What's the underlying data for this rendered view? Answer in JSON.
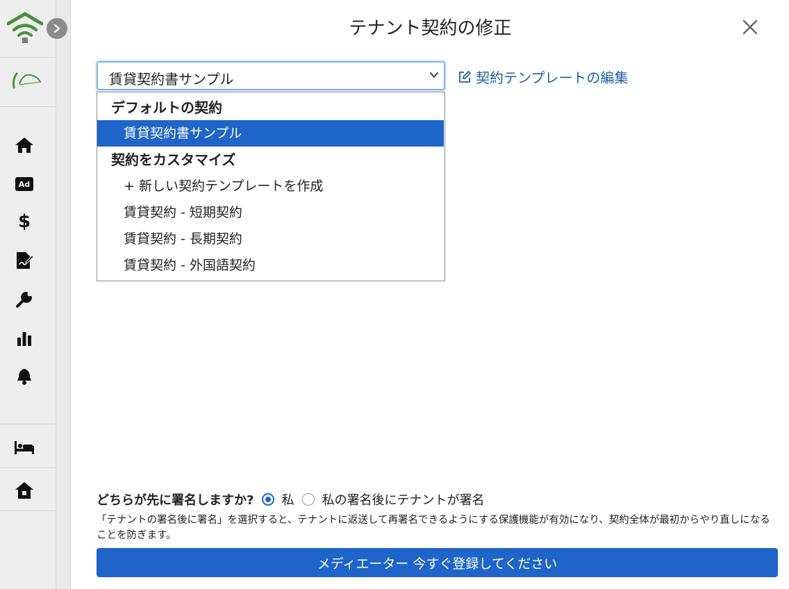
{
  "modal": {
    "title": "テナント契約の修正",
    "close_icon": "close-icon"
  },
  "contract_select": {
    "selected_value": "賃貸契約書サンプル",
    "edit_link_label": "契約テンプレートの編集"
  },
  "dropdown": {
    "group_default": "デフォルトの契約",
    "default_items": [
      "賃貸契約書サンプル"
    ],
    "group_custom": "契約をカスタマイズ",
    "custom_items": [
      "+ 新しい契約テンプレートを作成",
      "賃貸契約 - 短期契約",
      "賃貸契約 - 長期契約",
      "賃貸契約 - 外国語契約"
    ]
  },
  "signing": {
    "question": "どちらが先に署名しますか?",
    "option_me": "私",
    "option_tenant_after": "私の署名後にテナントが署名",
    "selected": "option_me",
    "note": "「テナントの署名後に署名」を選択すると、テナントに返送して再署名できるようにする保護機能が有効になり、契約全体が最初からやり直しになることを防ぎます。"
  },
  "primary_button": {
    "label": "メディエーター 今すぐ登録してください"
  },
  "sidebar": {
    "ad_label": "Ad",
    "dollar_symbol": "$",
    "icons": [
      "wifi-home-logo-icon",
      "sweethome-brand-icon",
      "home-icon",
      "ad-icon",
      "dollar-icon",
      "contract-sign-icon",
      "wrench-icon",
      "bar-chart-icon",
      "bell-icon",
      "bed-icon",
      "house-icon"
    ]
  },
  "colors": {
    "primary": "#1f65c9",
    "link": "#1d5fa8",
    "logo_green": "#4a8f3c"
  }
}
